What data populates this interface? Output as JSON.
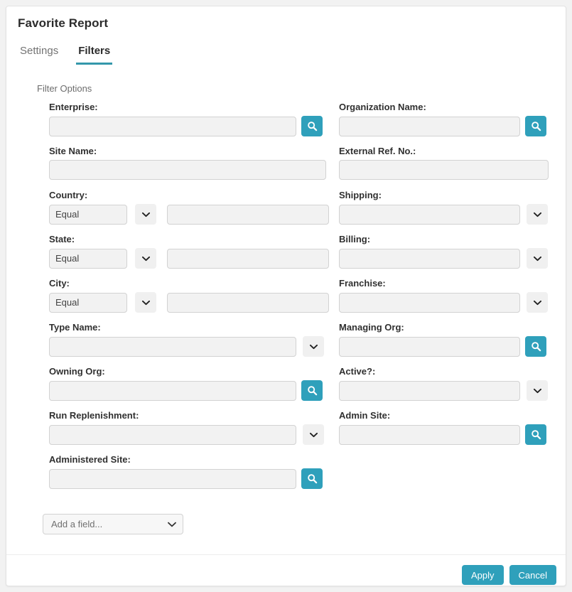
{
  "page": {
    "title": "Favorite Report"
  },
  "tabs": [
    {
      "label": "Settings",
      "active": false
    },
    {
      "label": "Filters",
      "active": true
    }
  ],
  "section": {
    "label": "Filter Options"
  },
  "fields": {
    "enterprise": {
      "label": "Enterprise:",
      "value": "",
      "placeholder": ""
    },
    "organization_name": {
      "label": "Organization Name:",
      "value": "",
      "placeholder": ""
    },
    "site_name": {
      "label": "Site Name:",
      "value": "",
      "placeholder": ""
    },
    "external_ref_no": {
      "label": "External Ref. No.:",
      "value": "",
      "placeholder": ""
    },
    "country": {
      "label": "Country:",
      "operator": "Equal",
      "value": "",
      "placeholder": ""
    },
    "shipping": {
      "label": "Shipping:",
      "value": "",
      "placeholder": ""
    },
    "state": {
      "label": "State:",
      "operator": "Equal",
      "value": "",
      "placeholder": ""
    },
    "billing": {
      "label": "Billing:",
      "value": "",
      "placeholder": ""
    },
    "city": {
      "label": "City:",
      "operator": "Equal",
      "value": "",
      "placeholder": ""
    },
    "franchise": {
      "label": "Franchise:",
      "value": "",
      "placeholder": ""
    },
    "type_name": {
      "label": "Type Name:",
      "value": "",
      "placeholder": ""
    },
    "managing_org": {
      "label": "Managing Org:",
      "value": "",
      "placeholder": ""
    },
    "owning_org": {
      "label": "Owning Org:",
      "value": "",
      "placeholder": ""
    },
    "active": {
      "label": "Active?:",
      "value": "",
      "placeholder": ""
    },
    "run_replenishment": {
      "label": "Run Replenishment:",
      "value": "",
      "placeholder": ""
    },
    "admin_site": {
      "label": "Admin Site:",
      "value": "",
      "placeholder": ""
    },
    "administered_site": {
      "label": "Administered Site:",
      "value": "",
      "placeholder": ""
    }
  },
  "add_field": {
    "label": "Add a field..."
  },
  "footer": {
    "apply_label": "Apply",
    "cancel_label": "Cancel"
  },
  "colors": {
    "accent": "#2fa0bb",
    "tab_underline": "#3498ab",
    "input_bg": "#f2f2f2",
    "card_bg": "#ffffff",
    "page_bg": "#f2f2f2"
  }
}
